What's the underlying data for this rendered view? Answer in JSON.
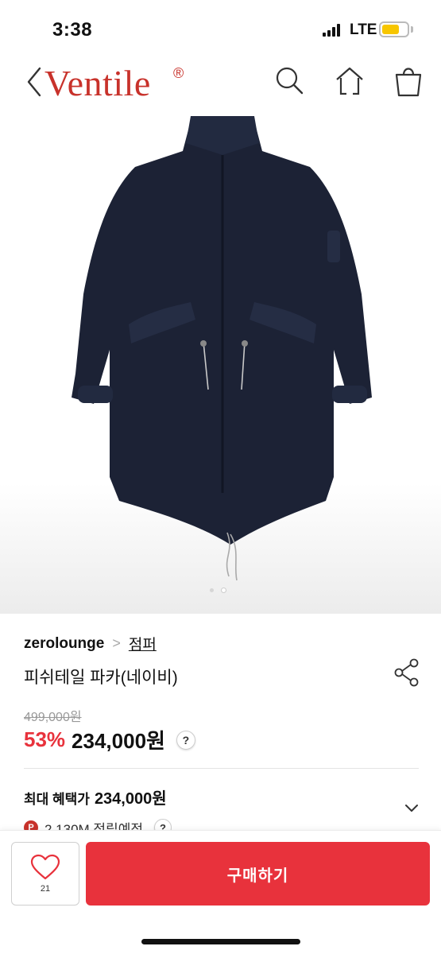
{
  "status_bar": {
    "time": "3:38",
    "network": "LTE",
    "battery_color": "#f7c600"
  },
  "header": {
    "brand": "Ventile",
    "brand_mark": "®",
    "brand_color": "#c8322b",
    "icons": [
      "back-chevron-icon",
      "search-icon",
      "home-icon",
      "shopping-bag-icon"
    ]
  },
  "gallery": {
    "slides_total": 2,
    "current_slide": 1
  },
  "product": {
    "seller": "zerolounge",
    "breadcrumb_separator": ">",
    "category": "점퍼",
    "title": "피쉬테일 파카(네이비)",
    "original_price": "499,000원",
    "discount": "53%",
    "price": "234,000원",
    "help_mark": "?",
    "max_benefit_label": "최대 혜택가",
    "max_benefit_price": "234,000원",
    "points_badge": "P",
    "points_text": "2,130M 적립예정"
  },
  "bottom_bar": {
    "like_count": "21",
    "buy_label": "구매하기",
    "accent_color": "#e8323c"
  }
}
